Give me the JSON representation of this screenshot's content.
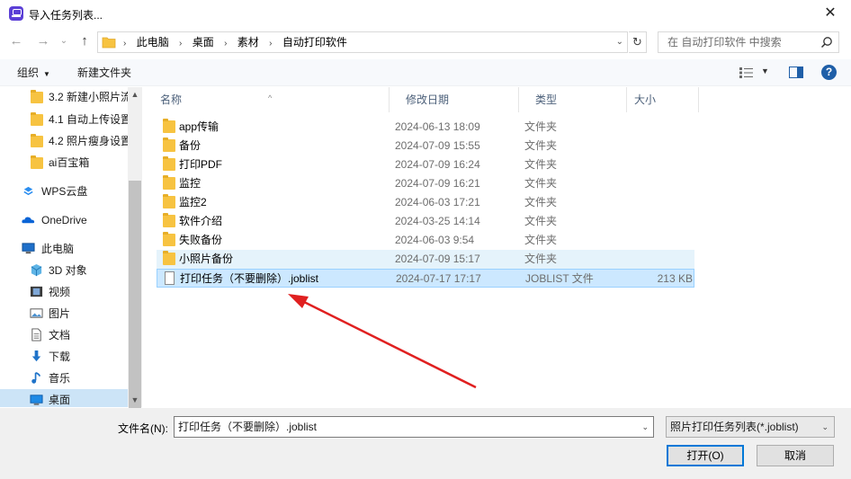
{
  "window": {
    "title": "导入任务列表...",
    "close_glyph": "✕"
  },
  "nav": {
    "back_glyph": "←",
    "forward_glyph": "→",
    "dropdown_glyph": "⌄",
    "up_glyph": "↑",
    "breadcrumb": [
      "此电脑",
      "桌面",
      "素材",
      "自动打印软件"
    ],
    "sep_glyph": "›",
    "refresh_glyph": "↻",
    "search_placeholder": "在 自动打印软件 中搜索"
  },
  "commands": {
    "organize": "组织",
    "organize_caret": "▼",
    "new_folder": "新建文件夹",
    "view_caret": "▼",
    "help": "?"
  },
  "sidebar": {
    "items": [
      {
        "label": "3.2 新建小照片流",
        "icon": "folder-icon"
      },
      {
        "label": "4.1 自动上传设置",
        "icon": "folder-icon"
      },
      {
        "label": "4.2 照片瘦身设置",
        "icon": "folder-icon"
      },
      {
        "label": "ai百宝箱",
        "icon": "folder-icon"
      },
      {
        "label": "WPS云盘",
        "icon": "cloud-icon"
      },
      {
        "label": "OneDrive",
        "icon": "onedrive-icon"
      },
      {
        "label": "此电脑",
        "icon": "computer-icon"
      },
      {
        "label": "3D 对象",
        "icon": "cube-icon"
      },
      {
        "label": "视频",
        "icon": "video-icon"
      },
      {
        "label": "图片",
        "icon": "picture-icon"
      },
      {
        "label": "文档",
        "icon": "document-icon"
      },
      {
        "label": "下载",
        "icon": "download-icon"
      },
      {
        "label": "音乐",
        "icon": "music-icon"
      },
      {
        "label": "桌面",
        "icon": "desktop-icon"
      }
    ],
    "scroll_up": "▲",
    "scroll_down": "▼"
  },
  "columns": {
    "name": "名称",
    "date": "修改日期",
    "type": "类型",
    "size": "大小",
    "sort_glyph": "^"
  },
  "files": [
    {
      "name": "app传输",
      "date": "2024-06-13 18:09",
      "type": "文件夹",
      "size": "",
      "kind": "folder"
    },
    {
      "name": "备份",
      "date": "2024-07-09 15:55",
      "type": "文件夹",
      "size": "",
      "kind": "folder"
    },
    {
      "name": "打印PDF",
      "date": "2024-07-09 16:24",
      "type": "文件夹",
      "size": "",
      "kind": "folder"
    },
    {
      "name": "监控",
      "date": "2024-07-09 16:21",
      "type": "文件夹",
      "size": "",
      "kind": "folder"
    },
    {
      "name": "监控2",
      "date": "2024-06-03 17:21",
      "type": "文件夹",
      "size": "",
      "kind": "folder"
    },
    {
      "name": "软件介绍",
      "date": "2024-03-25 14:14",
      "type": "文件夹",
      "size": "",
      "kind": "folder"
    },
    {
      "name": "失败备份",
      "date": "2024-06-03 9:54",
      "type": "文件夹",
      "size": "",
      "kind": "folder"
    },
    {
      "name": "小照片备份",
      "date": "2024-07-09 15:17",
      "type": "文件夹",
      "size": "",
      "kind": "folder"
    },
    {
      "name": "打印任务（不要删除）.joblist",
      "date": "2024-07-17 17:17",
      "type": "JOBLIST 文件",
      "size": "213 KB",
      "kind": "file"
    }
  ],
  "bottom": {
    "filename_label": "文件名(N):",
    "filename_value": "打印任务（不要删除）.joblist",
    "filetype_value": "照片打印任务列表(*.joblist)",
    "open_button": "打开(O)",
    "cancel_button": "取消",
    "chev_glyph": "⌄"
  },
  "colors": {
    "accent": "#0078d7",
    "folder": "#f7c341",
    "selected_row": "#cce8ff",
    "annotation_arrow": "#e02020"
  }
}
